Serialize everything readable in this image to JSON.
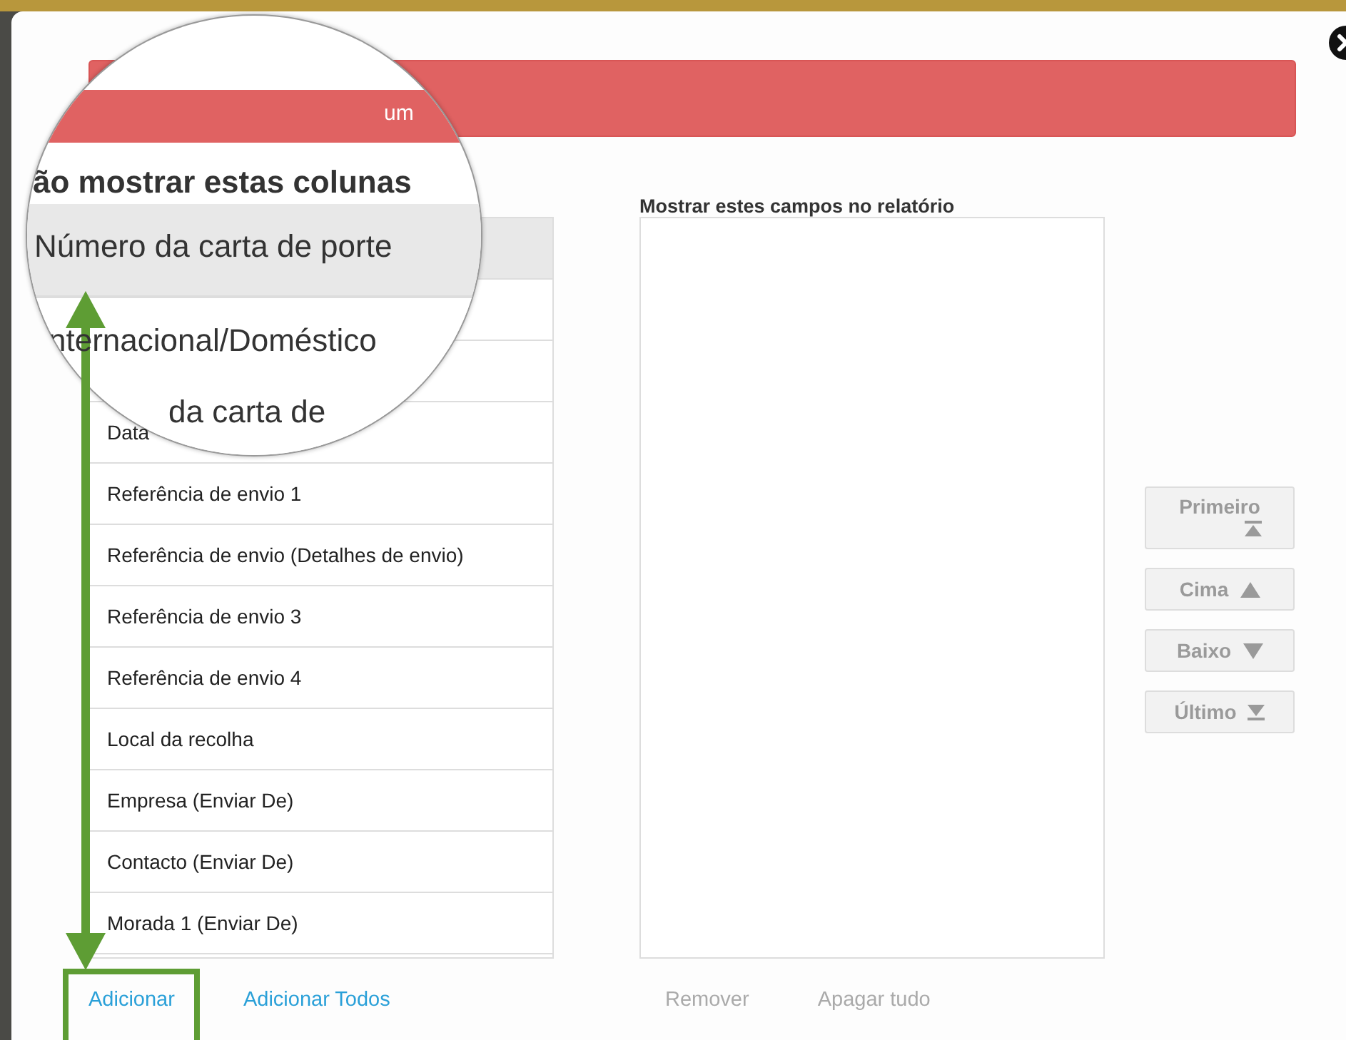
{
  "banner": {
    "text": "um"
  },
  "magnifier": {
    "heading": "ão mostrar estas colunas",
    "items": [
      {
        "text": "Número da carta de porte",
        "selected": true
      },
      {
        "text": "nternacional/Doméstico",
        "selected": false
      },
      {
        "text": "da carta de",
        "selected": false
      }
    ]
  },
  "available": {
    "items": [
      {
        "kind": "covered",
        "selected": true
      },
      {
        "kind": "covered",
        "selected": false
      },
      {
        "kind": "covered",
        "selected": false
      },
      {
        "kind": "text",
        "text": "Data",
        "selected": false
      },
      {
        "kind": "text",
        "text": "Referência de envio 1",
        "selected": false
      },
      {
        "kind": "text",
        "text": "Referência de envio (Detalhes de envio)",
        "selected": false
      },
      {
        "kind": "text",
        "text": "Referência de envio 3",
        "selected": false
      },
      {
        "kind": "text",
        "text": "Referência de envio 4",
        "selected": false
      },
      {
        "kind": "text",
        "text": "Local da recolha",
        "selected": false
      },
      {
        "kind": "text",
        "text": "Empresa (Enviar De)",
        "selected": false
      },
      {
        "kind": "text",
        "text": "Contacto (Enviar De)",
        "selected": false
      },
      {
        "kind": "text",
        "text": "Morada 1 (Enviar De)",
        "selected": false
      }
    ],
    "links": [
      {
        "label": "Adicionar",
        "disabled": false,
        "highlighted": true
      },
      {
        "label": "Adicionar Todos",
        "disabled": false,
        "highlighted": false
      }
    ]
  },
  "shown": {
    "heading": "Mostrar estes campos no relatório",
    "links": [
      {
        "label": "Remover",
        "disabled": true,
        "highlighted": false
      },
      {
        "label": "Apagar tudo",
        "disabled": true,
        "highlighted": false
      }
    ]
  },
  "order_buttons": [
    {
      "label": "Primeiro",
      "kind": "first",
      "disabled": true
    },
    {
      "label": "Cima",
      "kind": "up",
      "disabled": true
    },
    {
      "label": "Baixo",
      "kind": "down",
      "disabled": true
    },
    {
      "label": "Último",
      "kind": "last",
      "disabled": true
    }
  ]
}
